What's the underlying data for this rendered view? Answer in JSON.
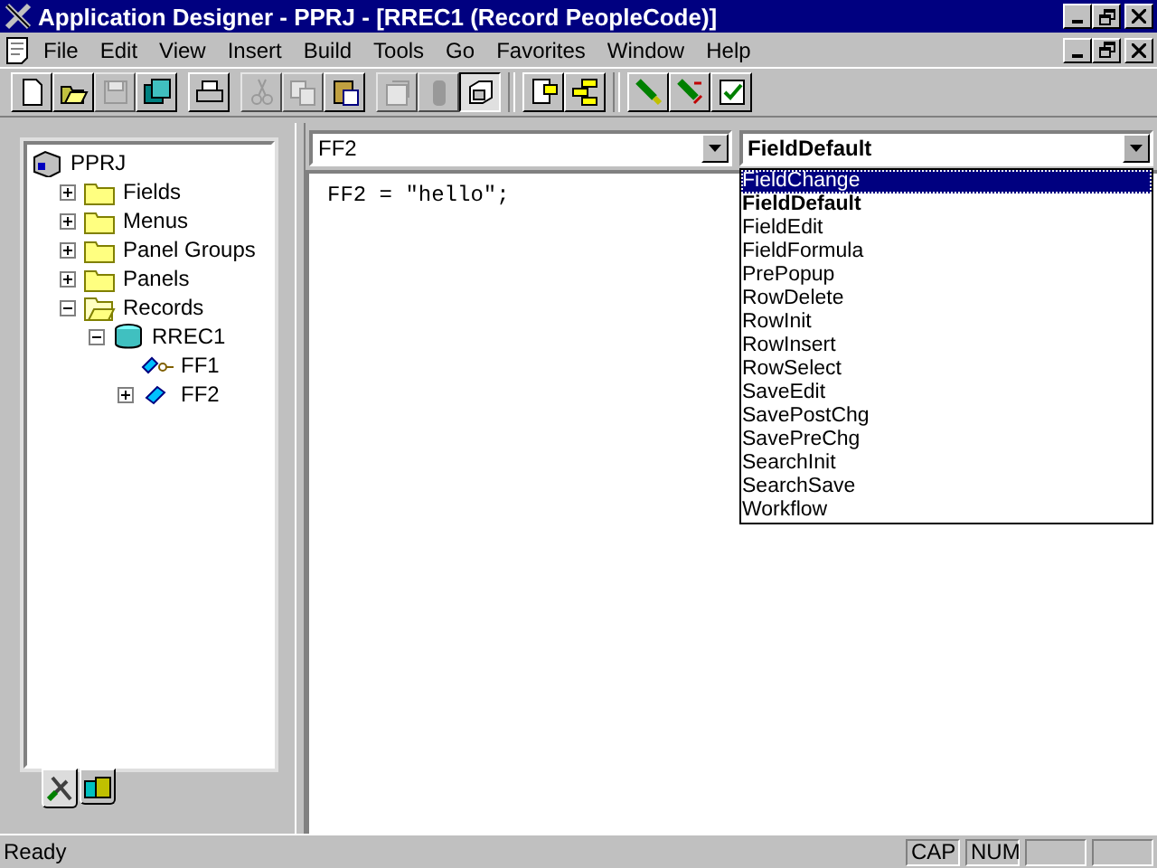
{
  "window": {
    "title": "Application Designer - PPRJ - [RREC1 (Record PeopleCode)]"
  },
  "menu": [
    {
      "label": "File"
    },
    {
      "label": "Edit"
    },
    {
      "label": "View"
    },
    {
      "label": "Insert"
    },
    {
      "label": "Build"
    },
    {
      "label": "Tools"
    },
    {
      "label": "Go"
    },
    {
      "label": "Favorites"
    },
    {
      "label": "Window"
    },
    {
      "label": "Help"
    }
  ],
  "toolbar": [
    [
      {
        "kind": "new",
        "disabled": false
      },
      {
        "kind": "open",
        "disabled": false
      },
      {
        "kind": "save",
        "disabled": true
      },
      {
        "kind": "saveall",
        "disabled": false
      }
    ],
    [
      {
        "kind": "print",
        "disabled": false
      }
    ],
    [
      {
        "kind": "cut",
        "disabled": true
      },
      {
        "kind": "copy",
        "disabled": true
      },
      {
        "kind": "paste",
        "disabled": false
      }
    ],
    [
      {
        "kind": "properties",
        "disabled": true
      },
      {
        "kind": "object",
        "disabled": true
      },
      {
        "kind": "projectview",
        "disabled": false,
        "pressed": true
      }
    ],
    [
      {
        "kind": "notes",
        "disabled": false
      },
      {
        "kind": "tree",
        "disabled": false
      }
    ],
    [
      {
        "kind": "find",
        "disabled": false
      },
      {
        "kind": "replace",
        "disabled": false
      },
      {
        "kind": "validate",
        "disabled": false
      }
    ]
  ],
  "tree": {
    "items": [
      {
        "label": "PPRJ",
        "kind": "project",
        "children": [
          {
            "label": "Fields",
            "kind": "folder",
            "expanded": false
          },
          {
            "label": "Menus",
            "kind": "folder",
            "expanded": false
          },
          {
            "label": "Panel Groups",
            "kind": "folder",
            "expanded": false
          },
          {
            "label": "Panels",
            "kind": "folder",
            "expanded": false
          },
          {
            "label": "Records",
            "kind": "folder",
            "expanded": true,
            "children": [
              {
                "label": "RREC1",
                "kind": "record",
                "expanded": true,
                "children": [
                  {
                    "label": "FF1",
                    "kind": "keyfield"
                  },
                  {
                    "label": "FF2",
                    "kind": "field",
                    "expanded": false
                  }
                ]
              }
            ]
          }
        ]
      }
    ]
  },
  "tree_tabs": [
    {
      "kind": "development",
      "selected": true
    },
    {
      "kind": "upgrade",
      "selected": false
    }
  ],
  "object_combo": {
    "value": "FF2"
  },
  "event_combo": {
    "value": "FieldDefault",
    "expanded": true,
    "options": [
      {
        "label": "FieldChange",
        "highlighted": true,
        "selected": false
      },
      {
        "label": "FieldDefault",
        "highlighted": false,
        "selected": true
      },
      {
        "label": "FieldEdit",
        "highlighted": false,
        "selected": false
      },
      {
        "label": "FieldFormula",
        "highlighted": false,
        "selected": false
      },
      {
        "label": "PrePopup",
        "highlighted": false,
        "selected": false
      },
      {
        "label": "RowDelete",
        "highlighted": false,
        "selected": false
      },
      {
        "label": "RowInit",
        "highlighted": false,
        "selected": false
      },
      {
        "label": "RowInsert",
        "highlighted": false,
        "selected": false
      },
      {
        "label": "RowSelect",
        "highlighted": false,
        "selected": false
      },
      {
        "label": "SaveEdit",
        "highlighted": false,
        "selected": false
      },
      {
        "label": "SavePostChg",
        "highlighted": false,
        "selected": false
      },
      {
        "label": "SavePreChg",
        "highlighted": false,
        "selected": false
      },
      {
        "label": "SearchInit",
        "highlighted": false,
        "selected": false
      },
      {
        "label": "SearchSave",
        "highlighted": false,
        "selected": false
      },
      {
        "label": "Workflow",
        "highlighted": false,
        "selected": false
      }
    ]
  },
  "code": {
    "text": "FF2 = \"hello\";"
  },
  "status_bar": {
    "message": "Ready",
    "indicators": [
      {
        "label": "CAP"
      },
      {
        "label": "NUM"
      }
    ]
  }
}
